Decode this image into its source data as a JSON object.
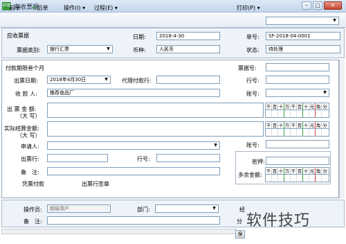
{
  "window": {
    "title": "应收票据",
    "app_icon": "可用",
    "min": "–",
    "max": "□",
    "close": "×"
  },
  "toolbar": {
    "prev": "前单",
    "next": "后单",
    "ops": "操作(I)",
    "process": "过程(E)",
    "print": "打印(P)",
    "print_dropdown_value": ""
  },
  "header": {
    "section_title": "应收票据",
    "date_label": "日期:",
    "date_value": "2018-4-30",
    "number_label": "单号:",
    "number_value": "SF-2018-04-0001",
    "bill_type_label": "票据类别:",
    "bill_type_value": "银行汇票",
    "currency_label": "币种:",
    "currency_value": "人民币",
    "status_label": "状态:",
    "status_value": "待处理"
  },
  "form": {
    "due_label": "付款期限叁个月",
    "bill_no_label": "票据号:",
    "issue_date_label": "出票日期:",
    "issue_date_value": "2018年4月30日",
    "agent_bank_label": "代理付款行:",
    "bank_no_label": "行号:",
    "payee_label": "收 款 人:",
    "payee_value": "推荐食品厂",
    "account_label": "账号:",
    "issue_amount_label": "出 票 金 额:",
    "issue_amount_sub": "（大 写）",
    "settle_amount_label": "实际结算金额:",
    "settle_amount_sub": "（大 写）",
    "digit_headers": [
      "千",
      "百",
      "十",
      "万",
      "千",
      "百",
      "十",
      "元",
      "角",
      "分"
    ],
    "account2_label": "账号:",
    "applicant_label": "申请人:",
    "drawer_bank_label": "出票行:",
    "bank_no2_label": "行号:",
    "password_label": "密押:",
    "remark_label": "备　注:",
    "surplus_label": "多余金额:",
    "voucher_label": "凭票付款",
    "sign_label": "出票行签章"
  },
  "footer": {
    "operator_label": "操作员:",
    "operator_value": "超级用户",
    "dept_label": "部门:",
    "remark_label": "备　注:",
    "cut_label1": "经",
    "cut_label2": "分",
    "save_button": "保"
  },
  "watermark": "软件技巧"
}
